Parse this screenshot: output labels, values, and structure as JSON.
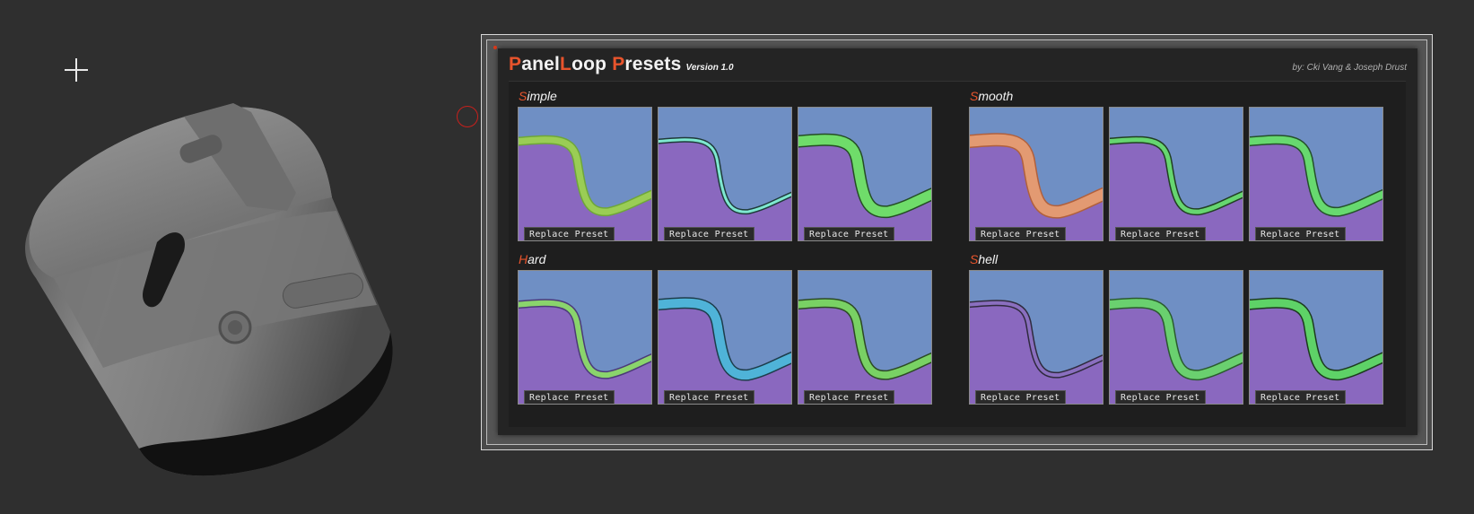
{
  "panel": {
    "title_parts": [
      {
        "text": "P",
        "accent": true
      },
      {
        "text": "anel",
        "accent": false
      },
      {
        "text": "L",
        "accent": true
      },
      {
        "text": "oop ",
        "accent": false
      },
      {
        "text": "P",
        "accent": true
      },
      {
        "text": "resets",
        "accent": false
      }
    ],
    "version": "Version 1.0",
    "author": "by: Cki Vang & Joseph Drust"
  },
  "colors": {
    "accent": "#e8542c",
    "thumb_blue": "#6f8fc4",
    "thumb_purple": "#8a68bf"
  },
  "sections": [
    {
      "key": "simple",
      "initial": "S",
      "rest": "imple",
      "presets": [
        {
          "label": "Replace Preset",
          "stroke": "#9acd55",
          "edge": "#6ea63a",
          "width": 7
        },
        {
          "label": "Replace Preset",
          "stroke": "#7ee8d0",
          "edge": "#1f3a3a",
          "width": 3
        },
        {
          "label": "Replace Preset",
          "stroke": "#6fdc6a",
          "edge": "#244d24",
          "width": 11
        }
      ]
    },
    {
      "key": "smooth",
      "initial": "S",
      "rest": "mooth",
      "presets": [
        {
          "label": "Replace Preset",
          "stroke": "#e39a72",
          "edge": "#b1603c",
          "width": 12
        },
        {
          "label": "Replace Preset",
          "stroke": "#66d670",
          "edge": "#213f23",
          "width": 5
        },
        {
          "label": "Replace Preset",
          "stroke": "#67d96f",
          "edge": "#24512a",
          "width": 8
        }
      ]
    },
    {
      "key": "hard",
      "initial": "H",
      "rest": "ard",
      "presets": [
        {
          "label": "Replace Preset",
          "stroke": "#8ad46c",
          "edge": "#4b3a78",
          "width": 6
        },
        {
          "label": "Replace Preset",
          "stroke": "#4fb3d8",
          "edge": "#1d3d4b",
          "width": 10
        },
        {
          "label": "Replace Preset",
          "stroke": "#79d164",
          "edge": "#2c4a24",
          "width": 8
        }
      ]
    },
    {
      "key": "shell",
      "initial": "S",
      "rest": "hell",
      "presets": [
        {
          "label": "Replace Preset",
          "stroke": "#8a6fbf",
          "edge": "#2f2a3e",
          "width": 4
        },
        {
          "label": "Replace Preset",
          "stroke": "#6ad06f",
          "edge": "#2a5a2e",
          "width": 9
        },
        {
          "label": "Replace Preset",
          "stroke": "#5ed267",
          "edge": "#1c3a1e",
          "width": 9
        }
      ]
    }
  ]
}
